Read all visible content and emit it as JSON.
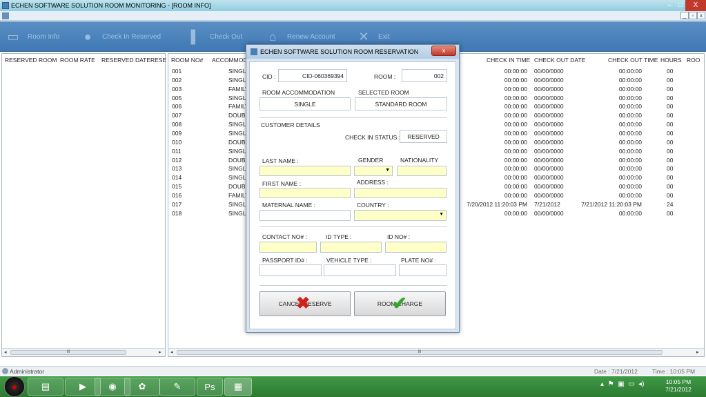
{
  "window": {
    "title": "ECHEN SOFTWARE SOLUTION ROOM MONITORING - [ROOM INFO]",
    "minimize": "–",
    "maximize": "□",
    "close": "X"
  },
  "mdi": {
    "minimize": "_",
    "maximize": "▫",
    "close": "x"
  },
  "toolbar": {
    "room_info": "Room Info",
    "check_in_reserved": "Check In Reserved",
    "check_out": "Check Out",
    "renew_account": "Renew Account",
    "exit": "Exit"
  },
  "left_table": {
    "headers": [
      "RESERVED ROOM",
      "ROOM RATE",
      "RESERVED DATE",
      "RESE"
    ]
  },
  "right_table": {
    "headers": [
      "ROOM NO#",
      "ACCOMMOD",
      "CHECK IN TIME",
      "CHECK OUT DATE",
      "CHECK OUT TIME",
      "HOURS",
      "ROO"
    ],
    "rows": [
      {
        "room": "001",
        "acc": "SINGLE",
        "in": "00:00:00",
        "outd": "00/00/0000",
        "outt": "00:00:00",
        "hrs": "00"
      },
      {
        "room": "002",
        "acc": "SINGLE",
        "in": "00:00:00",
        "outd": "00/00/0000",
        "outt": "00:00:00",
        "hrs": "00"
      },
      {
        "room": "003",
        "acc": "FAMILY",
        "in": "00:00:00",
        "outd": "00/00/0000",
        "outt": "00:00:00",
        "hrs": "00"
      },
      {
        "room": "005",
        "acc": "SINGLE",
        "in": "00:00:00",
        "outd": "00/00/0000",
        "outt": "00:00:00",
        "hrs": "00"
      },
      {
        "room": "006",
        "acc": "FAMILY",
        "in": "00:00:00",
        "outd": "00/00/0000",
        "outt": "00:00:00",
        "hrs": "00"
      },
      {
        "room": "007",
        "acc": "DOUBLE",
        "in": "00:00:00",
        "outd": "00/00/0000",
        "outt": "00:00:00",
        "hrs": "00"
      },
      {
        "room": "008",
        "acc": "SINGLE",
        "in": "00:00:00",
        "outd": "00/00/0000",
        "outt": "00:00:00",
        "hrs": "00"
      },
      {
        "room": "009",
        "acc": "SINGLE",
        "in": "00:00:00",
        "outd": "00/00/0000",
        "outt": "00:00:00",
        "hrs": "00"
      },
      {
        "room": "010",
        "acc": "DOUBLE",
        "in": "00:00:00",
        "outd": "00/00/0000",
        "outt": "00:00:00",
        "hrs": "00"
      },
      {
        "room": "011",
        "acc": "SINGLE",
        "in": "00:00:00",
        "outd": "00/00/0000",
        "outt": "00:00:00",
        "hrs": "00"
      },
      {
        "room": "012",
        "acc": "DOUBLE",
        "in": "00:00:00",
        "outd": "00/00/0000",
        "outt": "00:00:00",
        "hrs": "00"
      },
      {
        "room": "013",
        "acc": "SINGLE",
        "in": "00:00:00",
        "outd": "00/00/0000",
        "outt": "00:00:00",
        "hrs": "00"
      },
      {
        "room": "014",
        "acc": "SINGLE",
        "in": "00:00:00",
        "outd": "00/00/0000",
        "outt": "00:00:00",
        "hrs": "00"
      },
      {
        "room": "015",
        "acc": "DOUBLE",
        "in": "00:00:00",
        "outd": "00/00/0000",
        "outt": "00:00:00",
        "hrs": "00"
      },
      {
        "room": "016",
        "acc": "FAMILY",
        "in": "00:00:00",
        "outd": "00/00/0000",
        "outt": "00:00:00",
        "hrs": "00"
      },
      {
        "room": "017",
        "acc": "SINGLE",
        "in": "7/20/2012 11:20:03 PM",
        "outd": "7/21/2012",
        "outt": "7/21/2012 11:20:03 PM",
        "hrs": "24"
      },
      {
        "room": "018",
        "acc": "SINGLE",
        "in": "00:00:00",
        "outd": "00/00/0000",
        "outt": "00:00:00",
        "hrs": "00"
      }
    ]
  },
  "dialog": {
    "title": "ECHEN SOFTWARE SOLUTION ROOM RESERVATION",
    "close": "x",
    "cid_label": "CID :",
    "cid_value": "CID-060369394",
    "room_label": "ROOM :",
    "room_value": "002",
    "room_accommodation_label": "ROOM ACCOMMODATION",
    "room_accommodation_value": "SINGLE",
    "selected_room_label": "SELECTED ROOM",
    "selected_room_value": "STANDARD ROOM",
    "customer_details_label": "CUSTOMER DETAILS",
    "check_in_status_label": "CHECK IN STATUS :",
    "check_in_status_value": "RESERVED",
    "last_name_label": "LAST NAME :",
    "gender_label": "GENDER",
    "nationality_label": "NATIONALITY",
    "first_name_label": "FIRST NAME :",
    "address_label": "ADDRESS :",
    "maternal_name_label": "MATERNAL NAME :",
    "country_label": "COUNTRY :",
    "contact_label": "CONTACT NO# :",
    "id_type_label": "ID TYPE :",
    "id_no_label": "ID NO# :",
    "passport_label": "PASSPORT ID# :",
    "vehicle_type_label": "VEHICLE TYPE :",
    "plate_no_label": "PLATE NO# :",
    "cancel_button": "CANCEL RESERVE",
    "room_charge_button": "ROOM CHARGE"
  },
  "status": {
    "user": "Administrator",
    "date": "Date : 7/21/2012",
    "time": "Time : 10:05 PM"
  },
  "taskbar": {
    "clock_time": "10:05 PM",
    "clock_date": "7/21/2012",
    "ps_label": "Ps"
  },
  "colors": {
    "required_field": "#ffffc8",
    "toolbar": "#3f78b4",
    "taskbar": "#2c7a32"
  }
}
